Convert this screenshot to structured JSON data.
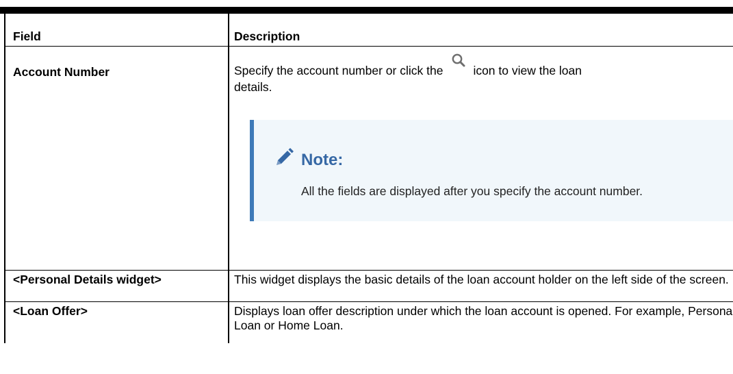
{
  "table": {
    "headers": [
      "Field",
      "Description"
    ],
    "rows": [
      {
        "field": "Account Number",
        "desc_before_icon": "Specify the account number or click the",
        "icon": "search-icon",
        "desc_after_icon": "icon to view the loan",
        "desc_line2": "details.",
        "note": {
          "title": "Note:",
          "icon": "pencil-icon",
          "text": "All the fields are displayed after you specify the account number."
        }
      },
      {
        "field": "<Personal Details widget>",
        "description": "This widget displays the basic details of the loan account holder on the left side of the screen."
      },
      {
        "field": "<Loan Offer>",
        "description": "Displays loan offer description under which the loan account is opened. For example, Personal Loan or Home Loan."
      }
    ]
  },
  "colors": {
    "note_accent": "#3e7ab8",
    "note_background": "#f1f7fb",
    "note_title": "#3668a5"
  }
}
